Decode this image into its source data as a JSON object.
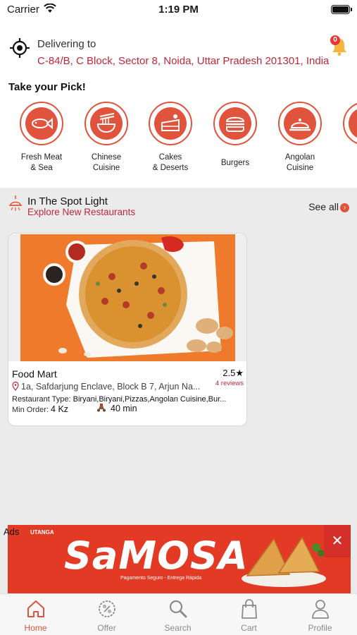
{
  "status_bar": {
    "carrier": "Carrier",
    "time": "1:19 PM"
  },
  "delivery": {
    "label": "Delivering to",
    "address": "C-84/B, C Block, Sector 8, Noida, Uttar Pradesh 201301, India",
    "notification_count": "0"
  },
  "categories": {
    "title": "Take your Pick!",
    "items": [
      {
        "label_line1": "Fresh Meat",
        "label_line2": "& Sea",
        "icon": "fish-icon"
      },
      {
        "label_line1": "Chinese",
        "label_line2": "Cuisine",
        "icon": "noodles-icon"
      },
      {
        "label_line1": "Cakes",
        "label_line2": "& Deserts",
        "icon": "cake-icon"
      },
      {
        "label_line1": "Burgers",
        "label_line2": "",
        "icon": "burger-icon"
      },
      {
        "label_line1": "Angolan",
        "label_line2": "Cuisine",
        "icon": "cloche-icon"
      }
    ]
  },
  "spotlight": {
    "title": "In The Spot Light",
    "subtitle": "Explore New Restaurants",
    "see_all": "See all"
  },
  "restaurant": {
    "name": "Food Mart",
    "rating": "2.5",
    "reviews": "4 reviews",
    "address": "1a, Safdarjung Enclave, Block B 7, Arjun Na...",
    "type_label": "Restaurant Type:",
    "type_value": "Biryani,Biryani,Pizzas,Angolan Cuisine,Bur...",
    "min_order_label": "Min Order:",
    "min_order_value": "4 Kz",
    "delivery_time": "40 min"
  },
  "ad": {
    "label": "Ads",
    "brand": "UTANGA",
    "title": "SaMOSA",
    "tagline": "Pagamento Seguro - Entrega Rápida"
  },
  "tabbar": {
    "active": "home",
    "items": [
      {
        "label": "Home"
      },
      {
        "label": "Offer"
      },
      {
        "label": "Search"
      },
      {
        "label": "Cart"
      },
      {
        "label": "Profile"
      }
    ]
  },
  "colors": {
    "accent": "#e0543e",
    "address_red": "#c0283a",
    "grey_bg": "#ebebeb"
  }
}
